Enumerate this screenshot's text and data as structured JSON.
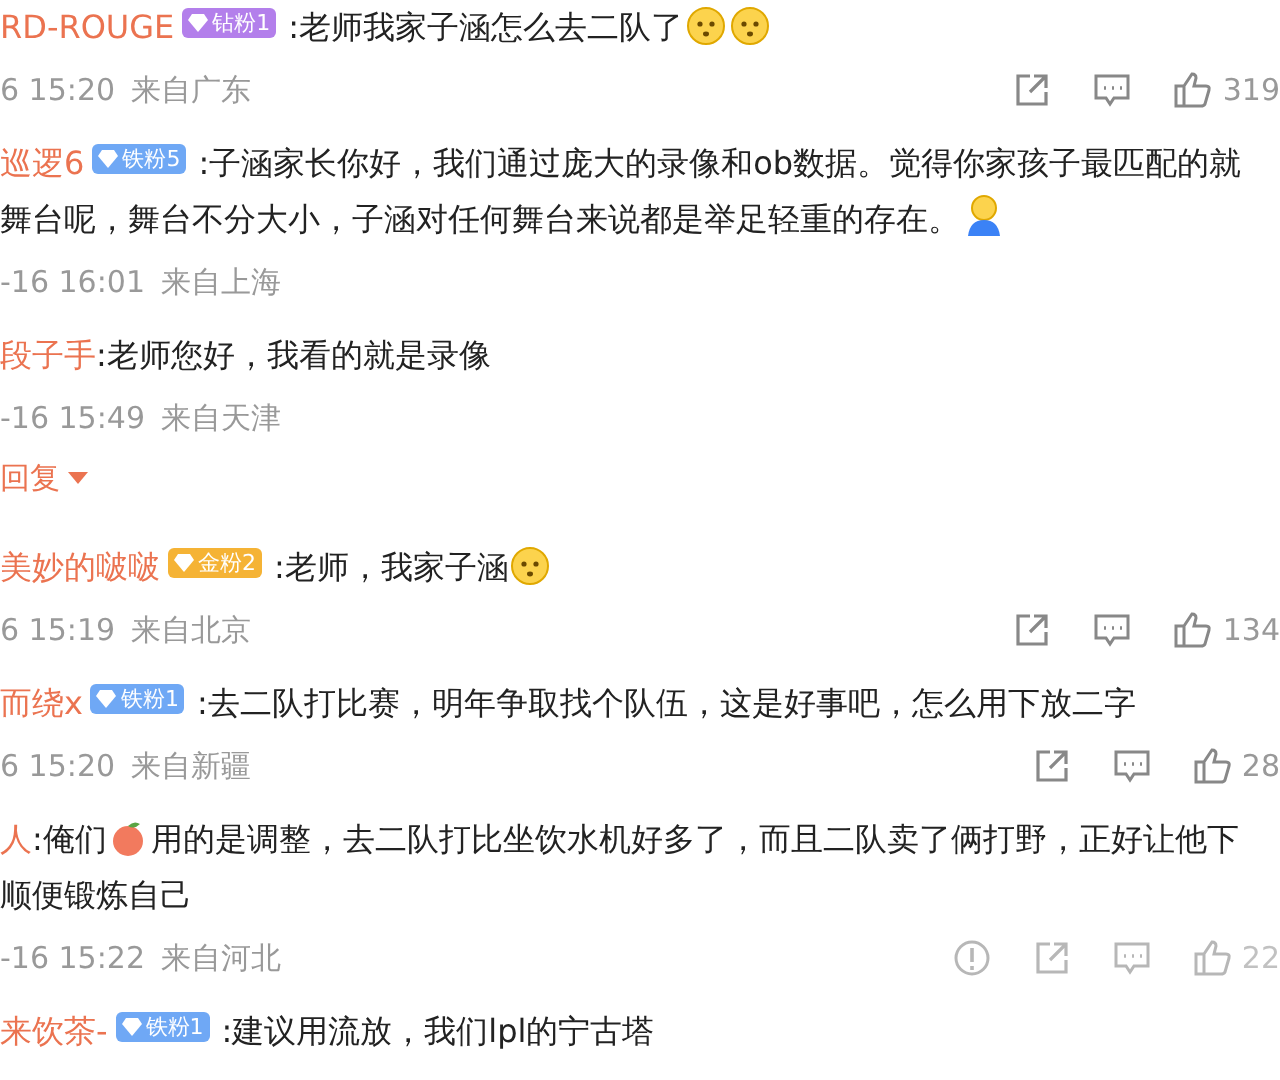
{
  "comments": [
    {
      "name": "RD-ROUGE",
      "badge": {
        "text": "钻粉1",
        "color": "#b37feb"
      },
      "content": [
        {
          "kind": "text",
          "text": ":老师我家子涵怎么去二队了"
        },
        {
          "kind": "emoji"
        },
        {
          "kind": "emoji"
        }
      ],
      "time": "6 15:20",
      "location": "来自广东",
      "actions": {
        "faded": false,
        "count": "319"
      }
    },
    {
      "name": "巡逻6",
      "badge": {
        "text": "铁粉5",
        "color": "#6fa8f5"
      },
      "content": [
        {
          "kind": "text",
          "text": ":子涵家长你好，我们通过庞大的录像和ob数据。觉得你家孩子最匹配的就"
        },
        {
          "kind": "break"
        },
        {
          "kind": "text",
          "text": "舞台呢，舞台不分大小，子涵对任何舞台来说都是举足轻重的存在。"
        },
        {
          "kind": "figure"
        }
      ],
      "time": "-16 16:01",
      "location": "来自上海"
    },
    {
      "name": "段子手",
      "content": [
        {
          "kind": "text",
          "text": ":老师您好，我看的就是录像"
        }
      ],
      "time": "-16 15:49",
      "location": "来自天津",
      "reply_toggle": "回复"
    },
    {
      "name": "美妙的啵啵",
      "badge": {
        "text": "金粉2",
        "color": "#f5b335"
      },
      "content": [
        {
          "kind": "text",
          "text": ":老师，我家子涵"
        },
        {
          "kind": "emoji"
        }
      ],
      "time": "6 15:19",
      "location": "来自北京",
      "actions": {
        "faded": false,
        "count": "134"
      }
    },
    {
      "name": "而绕x",
      "badge": {
        "text": "铁粉1",
        "color": "#6fa8f5"
      },
      "content": [
        {
          "kind": "text",
          "text": ":去二队打比赛，明年争取找个队伍，这是好事吧，怎么用下放二字"
        }
      ],
      "time": "6 15:20",
      "location": "来自新疆",
      "actions": {
        "faded": false,
        "count": "28"
      }
    },
    {
      "name": "人",
      "content": [
        {
          "kind": "text",
          "text": ":俺们"
        },
        {
          "kind": "fruit"
        },
        {
          "kind": "text",
          "text": "用的是调整，去二队打比坐饮水机好多了，而且二队卖了俩打野，正好让他下"
        },
        {
          "kind": "break"
        },
        {
          "kind": "text",
          "text": "顺便锻炼自己"
        }
      ],
      "time": "-16 15:22",
      "location": "来自河北",
      "actions": {
        "faded": true,
        "count": "22"
      }
    },
    {
      "name": "来饮茶-",
      "badge": {
        "text": "铁粉1",
        "color": "#6fa8f5"
      },
      "content": [
        {
          "kind": "text",
          "text": ":建议用流放，我们lpl的宁古塔"
        }
      ]
    }
  ]
}
